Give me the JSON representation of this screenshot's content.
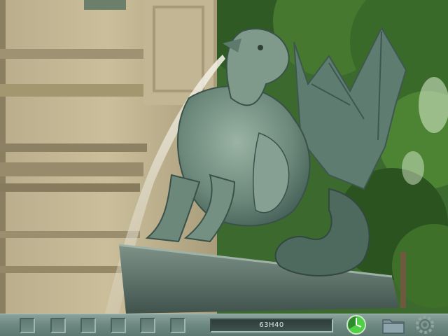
{
  "hud": {
    "inventory_slots": 6,
    "time_display": "63H40",
    "icons": [
      "clock-icon",
      "folder-icon",
      "gear-icon"
    ]
  },
  "colors": {
    "hud_base": "#6f8a83",
    "display_bg": "#34443f",
    "clock_green": "#3fbf3a"
  }
}
